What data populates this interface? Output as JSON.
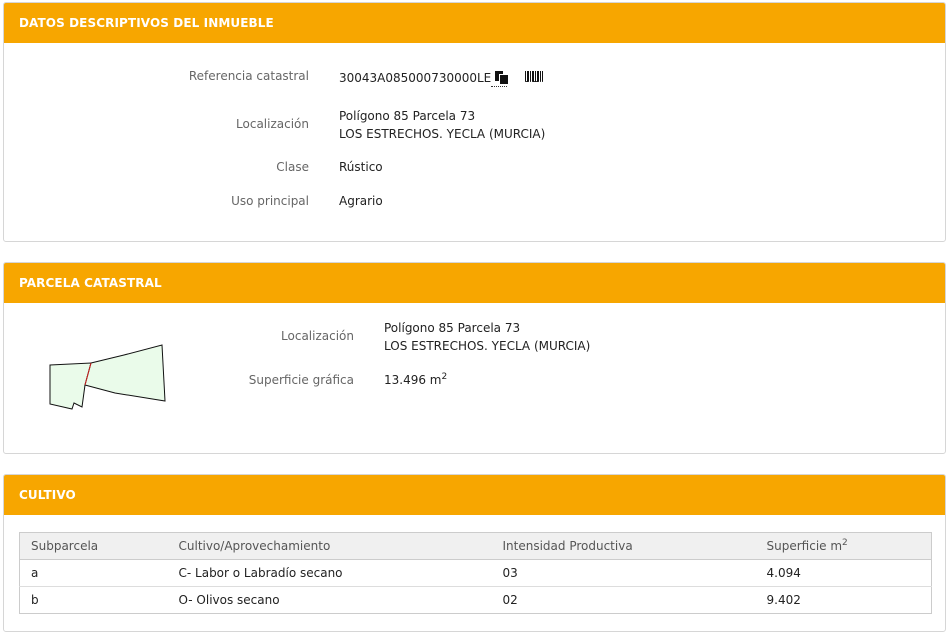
{
  "datos": {
    "header": "DATOS DESCRIPTIVOS DEL INMUEBLE",
    "ref_label": "Referencia catastral",
    "ref_value": "30043A085000730000LE",
    "loc_label": "Localización",
    "loc_line1": "Polígono 85 Parcela 73",
    "loc_line2": "LOS ESTRECHOS. YECLA (MURCIA)",
    "clase_label": "Clase",
    "clase_value": "Rústico",
    "uso_label": "Uso principal",
    "uso_value": "Agrario"
  },
  "parcela": {
    "header": "PARCELA CATASTRAL",
    "loc_label": "Localización",
    "loc_line1": "Polígono 85 Parcela 73",
    "loc_line2": "LOS ESTRECHOS. YECLA (MURCIA)",
    "sup_label": "Superficie gráfica",
    "sup_value": "13.496 m",
    "sup_unit_exp": "2"
  },
  "cultivo": {
    "header": "CULTIVO",
    "columns": [
      "Subparcela",
      "Cultivo/Aprovechamiento",
      "Intensidad Productiva",
      "Superficie m"
    ],
    "col_exp": "2",
    "rows": [
      [
        "a",
        "C- Labor o Labradío secano",
        "03",
        "4.094"
      ],
      [
        "b",
        "O- Olivos secano",
        "02",
        "9.402"
      ]
    ]
  },
  "icons": {
    "copy": "copy-icon",
    "barcode": "barcode-icon"
  },
  "colors": {
    "header_bg": "#f7a600",
    "parcel_fill": "#eafbea",
    "parcel_divider": "#cc2222"
  }
}
